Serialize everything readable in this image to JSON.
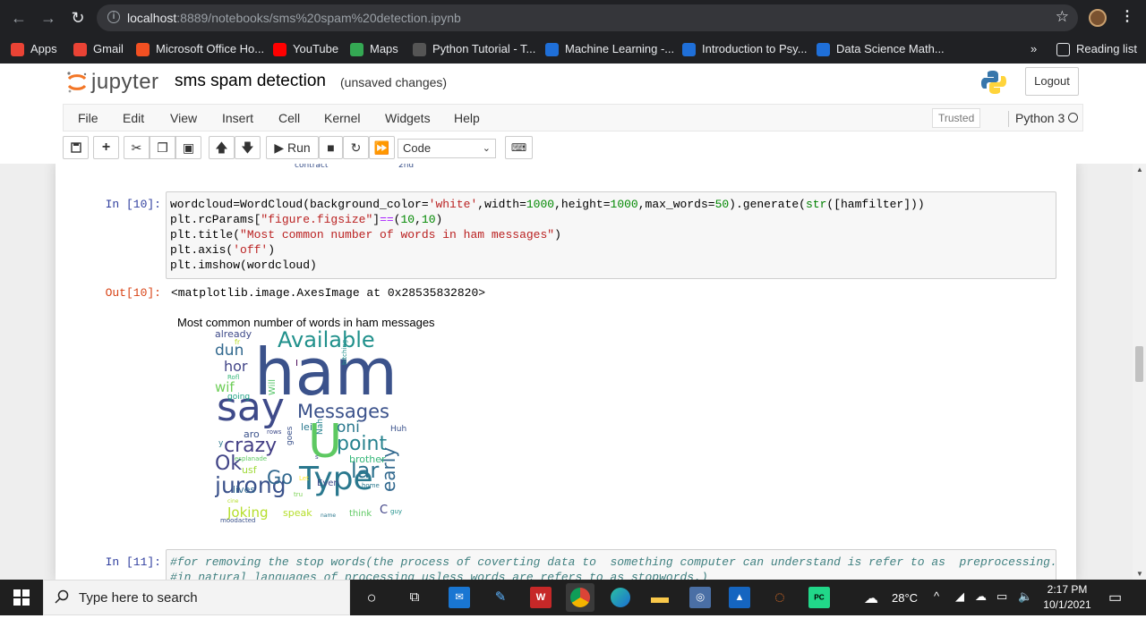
{
  "browser": {
    "url_host": "localhost",
    "url_path": ":8889/notebooks/sms%20spam%20detection.ipynb",
    "bookmarks": [
      {
        "label": "Apps",
        "icon": "apps-grid-icon",
        "color": "#ea4335"
      },
      {
        "label": "Gmail",
        "icon": "gmail-icon",
        "color": "#ea4335"
      },
      {
        "label": "Microsoft Office Ho...",
        "icon": "office-icon",
        "color": "#f25022"
      },
      {
        "label": "YouTube",
        "icon": "youtube-icon",
        "color": "#ff0000"
      },
      {
        "label": "Maps",
        "icon": "maps-icon",
        "color": "#34a853"
      },
      {
        "label": "Python Tutorial - T...",
        "icon": "python-tutorial-icon",
        "color": "#555555"
      },
      {
        "label": "Machine Learning -...",
        "icon": "coursera-icon",
        "color": "#1f6fd8"
      },
      {
        "label": "Introduction to Psy...",
        "icon": "coursera-icon",
        "color": "#1f6fd8"
      },
      {
        "label": "Data Science Math...",
        "icon": "coursera-icon",
        "color": "#1f6fd8"
      }
    ],
    "more": "»",
    "reading_list": "Reading list"
  },
  "jupyter": {
    "logo_text": "jupyter",
    "notebook_title": "sms spam detection",
    "save_status": "(unsaved changes)",
    "logout": "Logout",
    "menus": [
      "File",
      "Edit",
      "View",
      "Insert",
      "Cell",
      "Kernel",
      "Widgets",
      "Help"
    ],
    "trusted": "Trusted",
    "kernel": "Python 3",
    "run_label": "Run",
    "cell_type": "Code"
  },
  "notebook": {
    "prev_output_fragment_1": "contract",
    "prev_output_fragment_2": "2nd",
    "cell10": {
      "in_prompt": "In [10]:",
      "out_prompt": "Out[10]:",
      "output_text": "<matplotlib.image.AxesImage at 0x28535832820>",
      "figure_title": "Most common number of words in ham messages"
    },
    "cell11": {
      "in_prompt": "In [11]:",
      "line1": "#for removing the stop words(the process of coverting data to  something computer can understand is refer to as  preprocessing.",
      "line2": "#in natural languages of processing usless words are refers to as stopwords.)"
    }
  },
  "wordcloud": [
    {
      "t": "ham",
      "c": "#3b528b"
    },
    {
      "t": "say",
      "c": "#3e4a89"
    },
    {
      "t": "Available",
      "c": "#21918c"
    },
    {
      "t": "Messages",
      "c": "#3b528b"
    },
    {
      "t": "U",
      "c": "#5ec962"
    },
    {
      "t": "point",
      "c": "#26828e"
    },
    {
      "t": "Type",
      "c": "#2a788e"
    },
    {
      "t": "jurong",
      "c": "#3b528b"
    },
    {
      "t": "crazy",
      "c": "#433e85"
    },
    {
      "t": "Ok",
      "c": "#414487"
    },
    {
      "t": "Go",
      "c": "#31688e"
    },
    {
      "t": "lar",
      "c": "#2c728e"
    },
    {
      "t": "early",
      "c": "#31688e"
    },
    {
      "t": "oni",
      "c": "#2a788e"
    },
    {
      "t": "dun",
      "c": "#31688e"
    },
    {
      "t": "hor",
      "c": "#414487"
    },
    {
      "t": "wif",
      "c": "#6ece58"
    },
    {
      "t": "Joking",
      "c": "#b5de2b"
    },
    {
      "t": "already",
      "c": "#3e4a89"
    },
    {
      "t": "fr",
      "c": "#b8de29"
    },
    {
      "t": "Rofl",
      "c": "#35b779"
    },
    {
      "t": "going",
      "c": "#20a386"
    },
    {
      "t": "Will",
      "c": "#54c568"
    },
    {
      "t": "I",
      "c": "#440154"
    },
    {
      "t": "b",
      "c": "#3b528b"
    },
    {
      "t": "bitching",
      "c": "#21918c"
    },
    {
      "t": "lei",
      "c": "#2a788e"
    },
    {
      "t": "Nah",
      "c": "#26828e"
    },
    {
      "t": "Huh",
      "c": "#3b528b"
    },
    {
      "t": "aro",
      "c": "#3b528b"
    },
    {
      "t": "rows",
      "c": "#3e4a89"
    },
    {
      "t": "y",
      "c": "#2a788e"
    },
    {
      "t": "esplanade",
      "c": "#5ec962"
    },
    {
      "t": "goes",
      "c": "#3b528b"
    },
    {
      "t": "s",
      "c": "#3e4a89"
    },
    {
      "t": "brother",
      "c": "#35b779"
    },
    {
      "t": "usf",
      "c": "#a0da39"
    },
    {
      "t": "lives",
      "c": "#31688e"
    },
    {
      "t": "Even",
      "c": "#3e4a89"
    },
    {
      "t": "home",
      "c": "#2a788e"
    },
    {
      "t": "speak",
      "c": "#b5de2b"
    },
    {
      "t": "think",
      "c": "#5ec962"
    },
    {
      "t": "C",
      "c": "#414487"
    },
    {
      "t": "guy",
      "c": "#21918c"
    },
    {
      "t": "name",
      "c": "#2a788e"
    },
    {
      "t": "moodacted",
      "c": "#3b528b"
    },
    {
      "t": "cine",
      "c": "#b5de2b"
    },
    {
      "t": "Let",
      "c": "#fde725"
    },
    {
      "t": "tru",
      "c": "#7ad151"
    }
  ],
  "taskbar": {
    "search_placeholder": "Type here to search",
    "weather": "28°C",
    "time": "2:17 PM",
    "date": "10/1/2021"
  }
}
